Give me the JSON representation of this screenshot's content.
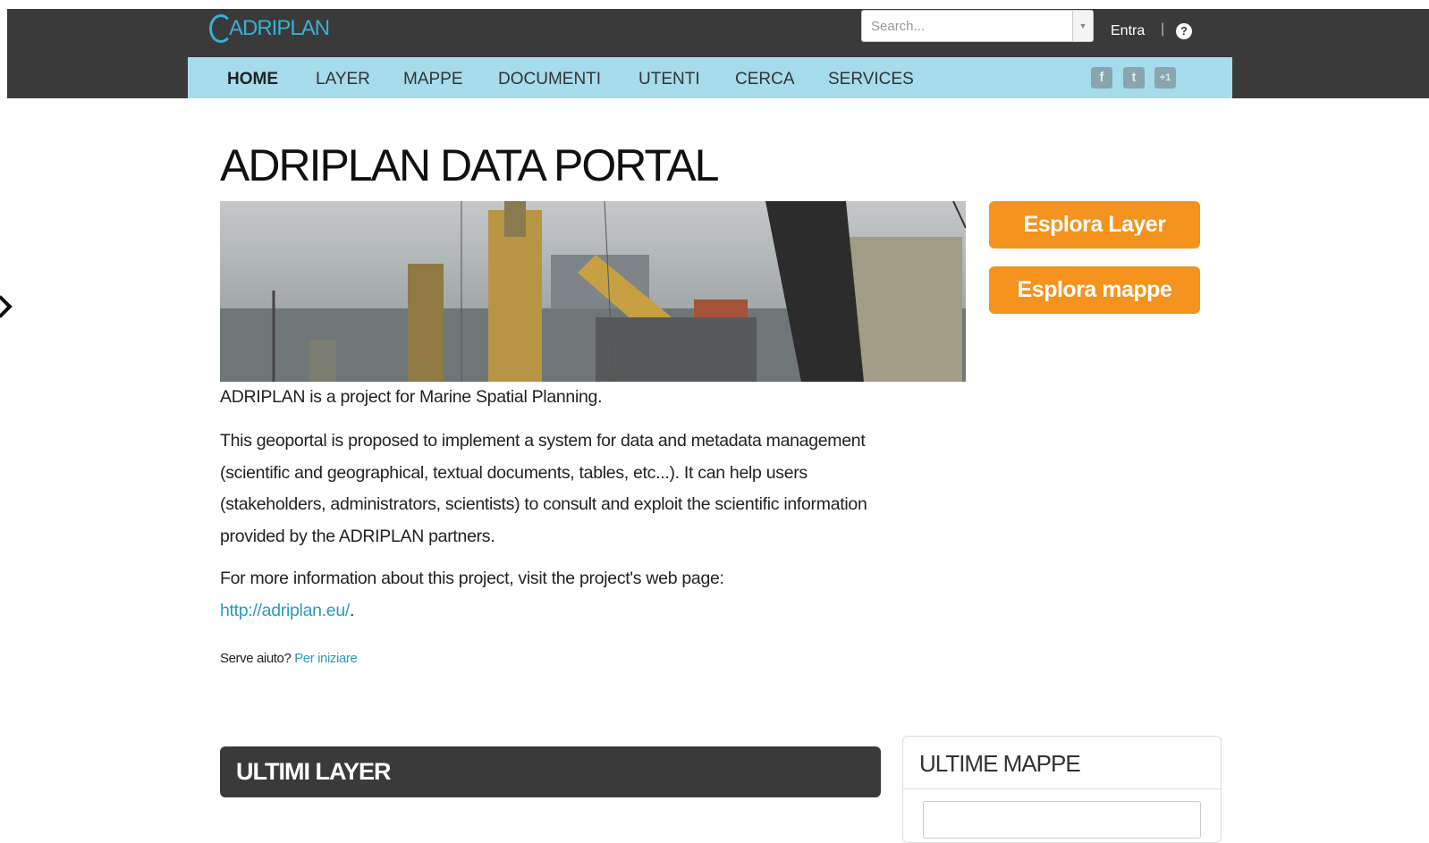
{
  "header": {
    "logo_text": "ADRIPLAN",
    "search": {
      "placeholder": "Search..."
    },
    "login_label": "Entra",
    "separator": "|",
    "help_icon": "?"
  },
  "nav": {
    "items": [
      "HOME",
      "LAYER",
      "MAPPE",
      "DOCUMENTI",
      "UTENTI",
      "CERCA",
      "SERVICES"
    ],
    "active": "HOME",
    "social": [
      {
        "icon": "facebook-icon",
        "glyph": "f"
      },
      {
        "icon": "twitter-icon",
        "glyph": "t"
      },
      {
        "icon": "google-plus-icon",
        "glyph": "+1"
      }
    ]
  },
  "main": {
    "title": "ADRIPLAN DATA PORTAL",
    "buttons": {
      "explore_layers": "Esplora Layer",
      "explore_maps": "Esplora mappe"
    },
    "intro": "ADRIPLAN is a project for Marine Spatial Planning.",
    "description": "This geoportal is proposed to implement a system for data and metadata management (scientific and geographical, textual documents, tables, etc...). It can help users (stakeholders, administrators, scientists) to consult and exploit the scientific information provided by the ADRIPLAN partners.",
    "more_info": "For more information about this project, visit the project's web page:",
    "project_link": "http://adriplan.eu/",
    "link_suffix": ".",
    "help_question": "Serve aiuto?",
    "help_link": "Per iniziare"
  },
  "panels": {
    "latest_layers": "ULTIMI LAYER",
    "latest_maps": "ULTIME MAPPE"
  },
  "colors": {
    "topbar": "#3a3a3a",
    "navbar": "#a6dcec",
    "accent_orange": "#f4931e",
    "link": "#2b9cc0",
    "logo": "#39b0d2"
  }
}
